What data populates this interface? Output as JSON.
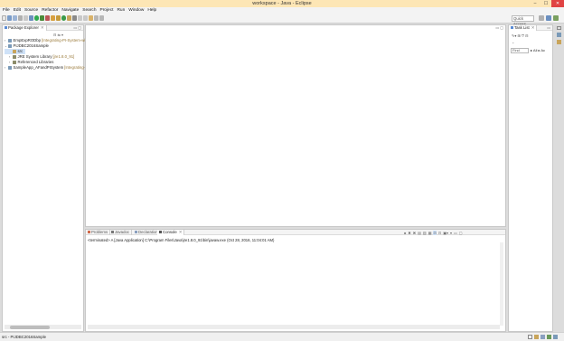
{
  "window": {
    "title": "workspace - Java - Eclipse",
    "controls": [
      "–",
      "☐",
      "✕"
    ]
  },
  "menu": [
    "File",
    "Edit",
    "Source",
    "Refactor",
    "Navigate",
    "Search",
    "Project",
    "Run",
    "Window",
    "Help"
  ],
  "toolbar": {
    "quick_access_placeholder": "Quick Access"
  },
  "package_explorer": {
    "tab_label": "Package Explorer",
    "items": [
      {
        "name": "EmpExpRODbp",
        "decoration": "[Integrating-PI-System-with"
      },
      {
        "name": "PIJDBC2016Sample",
        "decoration": ""
      },
      {
        "name": "src",
        "decoration": ""
      },
      {
        "name": "JRE System Library",
        "decoration": "[jre1.8.0_91]"
      },
      {
        "name": "Referenced Libraries",
        "decoration": ""
      },
      {
        "name": "SampleApp_AFandPISystem",
        "decoration": "[Integrating-Pi"
      }
    ]
  },
  "task_list": {
    "tab_label": "Task List",
    "find_placeholder": "Find",
    "filters": [
      "All",
      "Ac"
    ]
  },
  "bottom_tabs": [
    "Problems",
    "Javadoc",
    "Declaration",
    "Console"
  ],
  "console": {
    "text": "<terminated> A [Java Application] C:\\Program Files\\Java\\jre1.8.0_91\\bin\\javaw.exe (Oct 28, 2016, 11:04:01 AM)"
  },
  "status": {
    "text": "src - PIJDBC2016Sample"
  },
  "colors": {
    "titlebar": "#fde6b5",
    "close": "#e04343",
    "selection": "#cfe2f8"
  }
}
